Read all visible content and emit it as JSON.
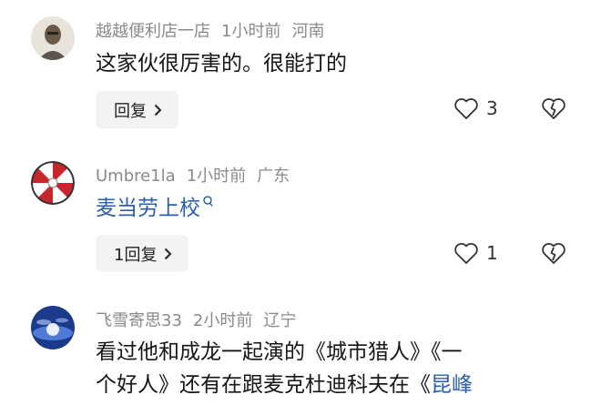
{
  "comments": [
    {
      "username": "越越便利店一店",
      "time": "1小时前",
      "location": "河南",
      "text": "这家伙很厉害的。很能打的",
      "reply_label": "回复",
      "like_count": "3"
    },
    {
      "username": "Umbre1la",
      "time": "1小时前",
      "location": "广东",
      "text": "麦当劳上校",
      "reply_label": "1回复",
      "like_count": "1"
    },
    {
      "username": "飞雪寄思33",
      "time": "2小时前",
      "location": "辽宁",
      "text_line1": "看过他和成龙一起演的《城市猎人》《一",
      "text_line2": "个好人》还有在跟麦克杜迪科夫在《",
      "text_line2_link": "昆峰"
    }
  ],
  "colors": {
    "link": "#2a5fb0",
    "meta": "#8a8a8a",
    "reply_bg": "#f3f3f3"
  },
  "icons": [
    "heart-outline-icon",
    "broken-heart-icon",
    "search-icon",
    "chevron-right-icon"
  ]
}
